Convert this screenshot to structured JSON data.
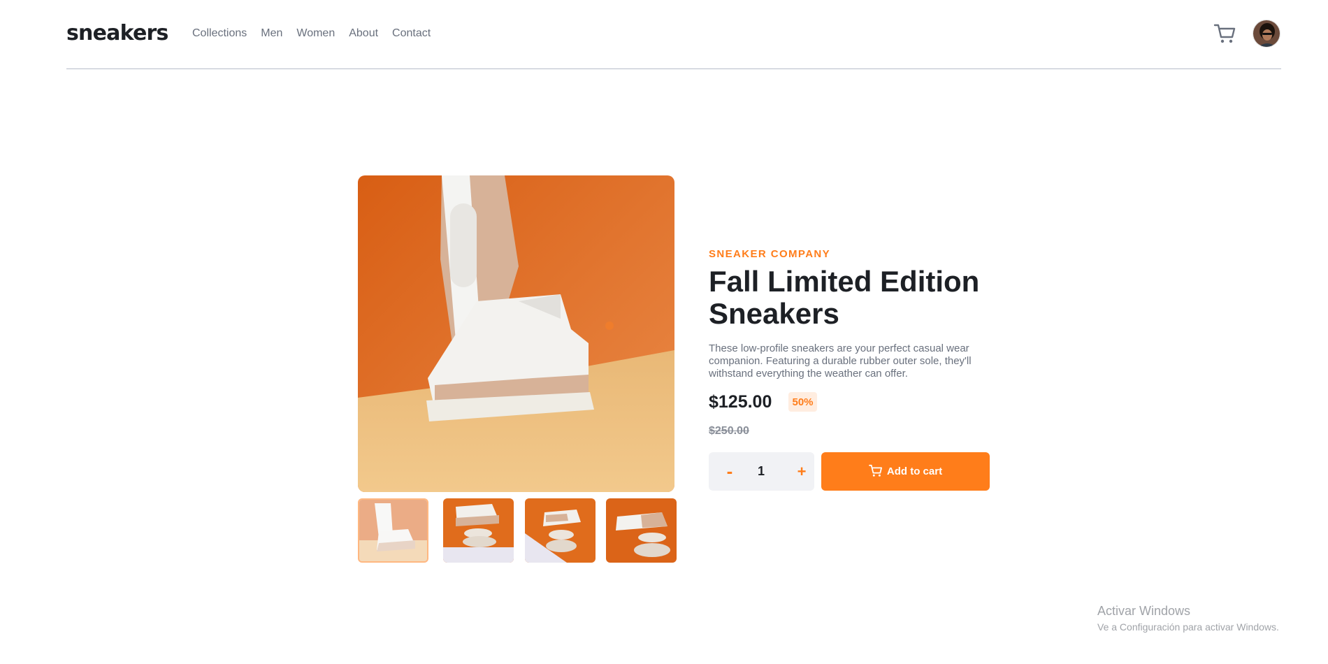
{
  "header": {
    "logo": "sneakers",
    "nav": [
      "Collections",
      "Men",
      "Women",
      "About",
      "Contact"
    ],
    "cart_icon": "cart-icon",
    "avatar_icon": "user-avatar"
  },
  "product": {
    "company": "SNEAKER COMPANY",
    "title": "Fall Limited Edition Sneakers",
    "description": "These low-profile sneakers are your perfect casual wear companion. Featuring a durable rubber outer sole, they'll withstand everything the weather can offer.",
    "price": "$125.00",
    "discount": "50%",
    "original_price": "$250.00"
  },
  "quantity": {
    "minus": "-",
    "value": "1",
    "plus": "+"
  },
  "add_to_cart": {
    "label": "Add to cart",
    "icon": "cart-icon"
  },
  "gallery": {
    "thumbnails": 4,
    "selected_index": 0
  },
  "colors": {
    "accent": "#ff7d1a",
    "pale_accent": "#ffede0",
    "dark": "#1d2025",
    "grey": "#69707d"
  },
  "os_watermark": {
    "line1": "Activar Windows",
    "line2": "Ve a Configuración para activar Windows."
  }
}
